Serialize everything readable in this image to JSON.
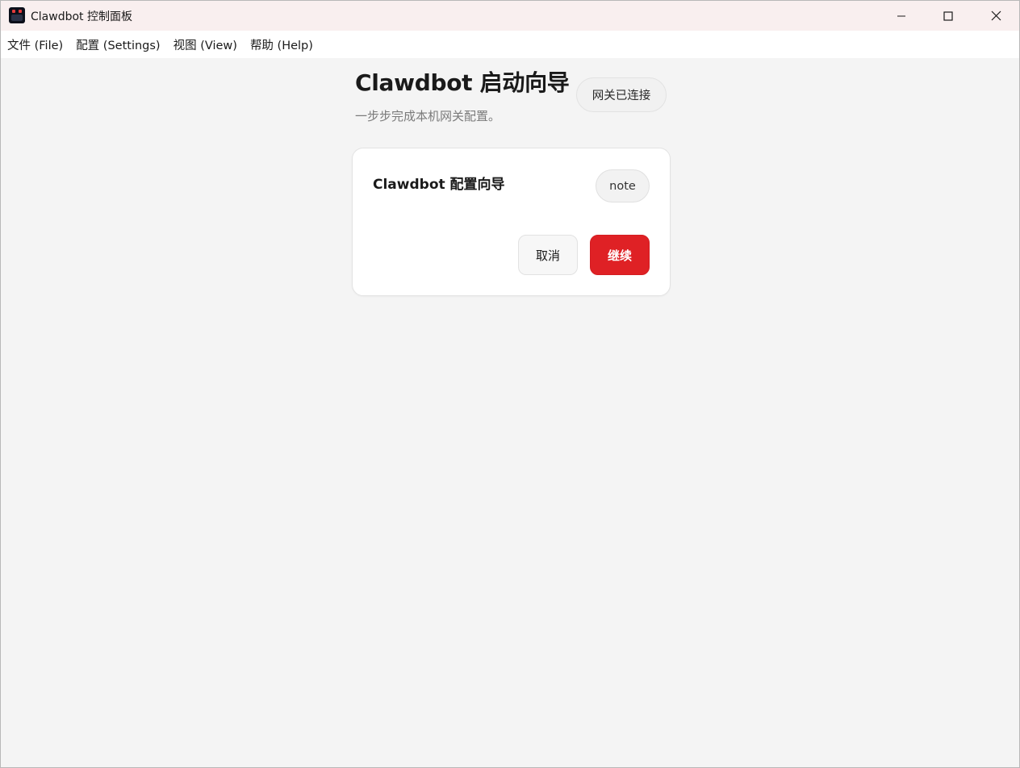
{
  "window": {
    "title": "Clawdbot 控制面板",
    "icon": "clawdbot-app-icon",
    "controls": [
      "minimize-icon",
      "maximize-icon",
      "close-icon"
    ]
  },
  "menu": {
    "items": [
      {
        "label": "文件 (File)"
      },
      {
        "label": "配置 (Settings)"
      },
      {
        "label": "视图 (View)"
      },
      {
        "label": "帮助 (Help)"
      }
    ]
  },
  "header": {
    "title": "Clawdbot 启动向导",
    "subtitle": "一步步完成本机网关配置。",
    "status": "网关已连接"
  },
  "card": {
    "title": "Clawdbot 配置向导",
    "badge": "note",
    "cancel_label": "取消",
    "continue_label": "继续"
  },
  "colors": {
    "accent": "#df2125",
    "titlebar": "#f9efef",
    "background": "#f4f4f4"
  }
}
